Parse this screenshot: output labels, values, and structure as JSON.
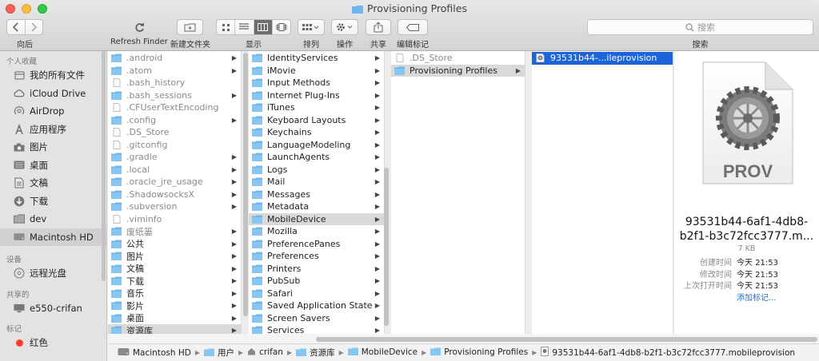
{
  "window": {
    "title": "Provisioning Profiles"
  },
  "toolbar": {
    "back_label": "向后",
    "refresh_label": "Refresh Finder",
    "newfolder_label": "新建文件夹",
    "view_label": "显示",
    "arrange_label": "排列",
    "action_label": "操作",
    "share_label": "共享",
    "tags_label": "编辑标记",
    "search_label": "搜索",
    "search_placeholder": "搜索"
  },
  "sidebar": {
    "favorites_header": "个人收藏",
    "favorites": [
      {
        "label": "我的所有文件",
        "icon": "all-files-icon"
      },
      {
        "label": "iCloud Drive",
        "icon": "cloud-icon"
      },
      {
        "label": "AirDrop",
        "icon": "airdrop-icon"
      },
      {
        "label": "应用程序",
        "icon": "apps-icon"
      },
      {
        "label": "图片",
        "icon": "camera-icon"
      },
      {
        "label": "桌面",
        "icon": "desktop-icon"
      },
      {
        "label": "文稿",
        "icon": "documents-icon"
      },
      {
        "label": "下载",
        "icon": "download-icon"
      },
      {
        "label": "dev",
        "icon": "folder-icon"
      },
      {
        "label": "Macintosh HD",
        "icon": "disk-icon"
      }
    ],
    "devices_header": "设备",
    "devices": [
      {
        "label": "远程光盘",
        "icon": "disc-icon"
      }
    ],
    "shared_header": "共享的",
    "shared": [
      {
        "label": "e550-crifan",
        "icon": "computer-icon"
      }
    ],
    "tags_header": "标记",
    "tags": [
      {
        "label": "红色",
        "color": "#ff3b30"
      }
    ]
  },
  "column1": [
    {
      "name": ".android",
      "type": "folder",
      "hidden": true,
      "arrow": true
    },
    {
      "name": ".atom",
      "type": "folder",
      "hidden": true,
      "arrow": true
    },
    {
      "name": ".bash_history",
      "type": "file",
      "hidden": true,
      "arrow": false
    },
    {
      "name": ".bash_sessions",
      "type": "folder",
      "hidden": true,
      "arrow": true
    },
    {
      "name": ".CFUserTextEncoding",
      "type": "file",
      "hidden": true,
      "arrow": false
    },
    {
      "name": ".config",
      "type": "folder",
      "hidden": true,
      "arrow": true
    },
    {
      "name": ".DS_Store",
      "type": "file",
      "hidden": true,
      "arrow": false
    },
    {
      "name": ".gitconfig",
      "type": "file",
      "hidden": true,
      "arrow": false
    },
    {
      "name": ".gradle",
      "type": "folder",
      "hidden": true,
      "arrow": true
    },
    {
      "name": ".local",
      "type": "folder",
      "hidden": true,
      "arrow": true
    },
    {
      "name": ".oracle_jre_usage",
      "type": "folder",
      "hidden": true,
      "arrow": true
    },
    {
      "name": ".ShadowsocksX",
      "type": "folder",
      "hidden": true,
      "arrow": true
    },
    {
      "name": ".subversion",
      "type": "folder",
      "hidden": true,
      "arrow": true
    },
    {
      "name": ".viminfo",
      "type": "file",
      "hidden": true,
      "arrow": false
    },
    {
      "name": "废纸篓",
      "type": "folder",
      "hidden": true,
      "arrow": true
    },
    {
      "name": "公共",
      "type": "folder",
      "hidden": false,
      "arrow": true
    },
    {
      "name": "图片",
      "type": "folder",
      "hidden": false,
      "arrow": true
    },
    {
      "name": "文稿",
      "type": "folder",
      "hidden": false,
      "arrow": true
    },
    {
      "name": "下载",
      "type": "folder",
      "hidden": false,
      "arrow": true
    },
    {
      "name": "音乐",
      "type": "folder",
      "hidden": false,
      "arrow": true
    },
    {
      "name": "影片",
      "type": "folder",
      "hidden": false,
      "arrow": true
    },
    {
      "name": "桌面",
      "type": "folder",
      "hidden": false,
      "arrow": true
    },
    {
      "name": "资源库",
      "type": "folder",
      "hidden": true,
      "arrow": true,
      "selected": true
    }
  ],
  "column2": [
    {
      "name": "IdentityServices",
      "arrow": true
    },
    {
      "name": "iMovie",
      "arrow": true
    },
    {
      "name": "Input Methods",
      "arrow": true
    },
    {
      "name": "Internet Plug-Ins",
      "arrow": true
    },
    {
      "name": "iTunes",
      "arrow": true
    },
    {
      "name": "Keyboard Layouts",
      "arrow": true
    },
    {
      "name": "Keychains",
      "arrow": true
    },
    {
      "name": "LanguageModeling",
      "arrow": true
    },
    {
      "name": "LaunchAgents",
      "arrow": true
    },
    {
      "name": "Logs",
      "arrow": true
    },
    {
      "name": "Mail",
      "arrow": true
    },
    {
      "name": "Messages",
      "arrow": true
    },
    {
      "name": "Metadata",
      "arrow": true
    },
    {
      "name": "MobileDevice",
      "arrow": true,
      "selected": true
    },
    {
      "name": "Mozilla",
      "arrow": true
    },
    {
      "name": "PreferencePanes",
      "arrow": true
    },
    {
      "name": "Preferences",
      "arrow": true
    },
    {
      "name": "Printers",
      "arrow": true
    },
    {
      "name": "PubSub",
      "arrow": true
    },
    {
      "name": "Safari",
      "arrow": true
    },
    {
      "name": "Saved Application State",
      "arrow": true
    },
    {
      "name": "Screen Savers",
      "arrow": true
    },
    {
      "name": "Services",
      "arrow": true
    }
  ],
  "column3": [
    {
      "name": ".DS_Store",
      "type": "file",
      "hidden": true,
      "arrow": false
    },
    {
      "name": "Provisioning Profiles",
      "type": "folder",
      "hidden": false,
      "arrow": true,
      "selected": true
    }
  ],
  "column4": [
    {
      "name": "93531b44-...ileprovision",
      "type": "provision",
      "selected": true
    }
  ],
  "preview": {
    "icon_text": "PROV",
    "name_line1": "93531b44-6af1-4db8-",
    "name_line2": "b2f1-b3c72fcc3777.m...",
    "size": "7 KB",
    "meta": [
      {
        "key": "创建时间",
        "value": "今天 21:53"
      },
      {
        "key": "修改时间",
        "value": "今天 21:53"
      },
      {
        "key": "上次打开时间",
        "value": "今天 21:53"
      }
    ],
    "add_tags": "添加标记..."
  },
  "pathbar": [
    {
      "label": "Macintosh HD",
      "icon": "disk-icon"
    },
    {
      "label": "用户",
      "icon": "folder-icon"
    },
    {
      "label": "crifan",
      "icon": "home-icon"
    },
    {
      "label": "资源库",
      "icon": "folder-icon"
    },
    {
      "label": "MobileDevice",
      "icon": "folder-icon"
    },
    {
      "label": "Provisioning Profiles",
      "icon": "folder-icon"
    },
    {
      "label": "93531b44-6af1-4db8-b2f1-b3c72fcc3777.mobileprovision",
      "icon": "gear-file-icon"
    }
  ]
}
